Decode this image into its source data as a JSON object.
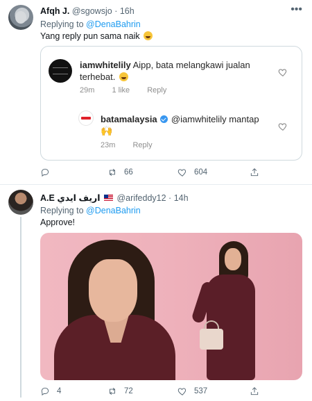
{
  "colors": {
    "accent": "#1d9bf0",
    "text": "#0f1419",
    "secondary": "#536471",
    "brand_red": "#e0212a"
  },
  "tweet1": {
    "display_name": "Afqh J.",
    "handle": "@sgowsjo",
    "separator": "·",
    "time": "16h",
    "more_icon": "more-icon",
    "replying_prefix": "Replying to",
    "replying_mention": "@DenaBahrin",
    "text": "Yang reply pun sama naik",
    "quote": {
      "comment1": {
        "user": "iamwhitelily",
        "text_line1": "Aipp, bata melangkawi jualan",
        "text_line2": "terhebat.",
        "time": "29m",
        "likes": "1 like",
        "reply": "Reply"
      },
      "comment2": {
        "user": "batamalaysia",
        "text": "@iamwhitelily mantap",
        "time": "23m",
        "reply": "Reply"
      }
    },
    "actions": {
      "reply_count": "",
      "retweet_count": "66",
      "like_count": "604"
    }
  },
  "tweet2": {
    "display_name": "A.E اريف ايدي",
    "handle": "@arifeddy12",
    "separator": "·",
    "time": "14h",
    "replying_prefix": "Replying to",
    "replying_mention": "@DenaBahrin",
    "text": "Approve!",
    "actions": {
      "reply_count": "4",
      "retweet_count": "72",
      "like_count": "537"
    }
  }
}
